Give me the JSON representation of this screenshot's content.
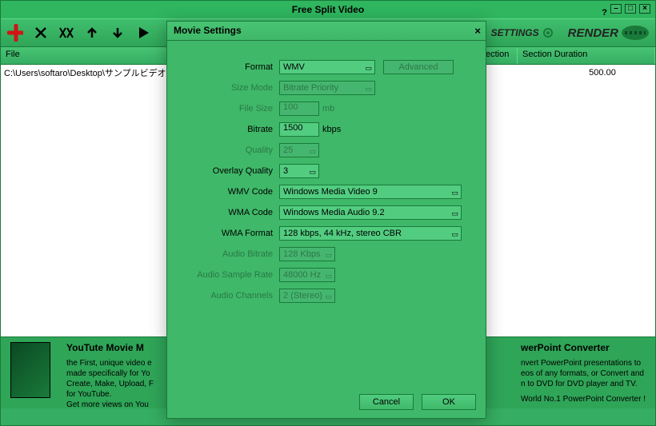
{
  "window": {
    "title": "Free Split Video"
  },
  "toolbar": {
    "settings_label": "SETTINGS",
    "render_label": "RENDER"
  },
  "grid": {
    "headers": {
      "file": "File",
      "section": "ection",
      "section_duration": "Section Duration"
    },
    "rows": [
      {
        "file": "C:\\Users\\softaro\\Desktop\\サンプルビデオ",
        "section": "",
        "duration": "500.00"
      }
    ]
  },
  "promo": {
    "left_title": "YouTute Movie M",
    "left_line1": "the First, unique video e",
    "left_line2": "made specifically for Yo",
    "left_line3": "Create, Make, Upload, F",
    "left_line4": "for YouTube.",
    "left_line5": "Get more views on You",
    "right_title": "werPoint Converter",
    "right_line1": "nvert PowerPoint presentations to",
    "right_line2": "eos of any formats, or Convert and",
    "right_line3": "n to DVD for DVD player and TV.",
    "right_line4": "World No.1 PowerPoint Converter !"
  },
  "modal": {
    "title": "Movie Settings",
    "labels": {
      "format": "Format",
      "size_mode": "Size Mode",
      "file_size": "File Size",
      "bitrate": "Bitrate",
      "quality": "Quality",
      "overlay_quality": "Overlay Quality",
      "wmv_code": "WMV Code",
      "wma_code": "WMA Code",
      "wma_format": "WMA Format",
      "audio_bitrate": "Audio Bitrate",
      "audio_sample_rate": "Audio Sample Rate",
      "audio_channels": "Audio Channels"
    },
    "values": {
      "format": "WMV",
      "size_mode": "Bitrate Priority",
      "file_size": "100",
      "bitrate": "1500",
      "quality": "25",
      "overlay_quality": "3",
      "wmv_code": "Windows Media Video 9",
      "wma_code": "Windows Media Audio 9.2",
      "wma_format": "128 kbps, 44 kHz, stereo CBR",
      "audio_bitrate": "128 Kbps",
      "audio_sample_rate": "48000 Hz",
      "audio_channels": "2 (Stereo)"
    },
    "units": {
      "file_size": "mb",
      "bitrate": "kbps"
    },
    "buttons": {
      "advanced": "Advanced",
      "cancel": "Cancel",
      "ok": "OK"
    }
  }
}
